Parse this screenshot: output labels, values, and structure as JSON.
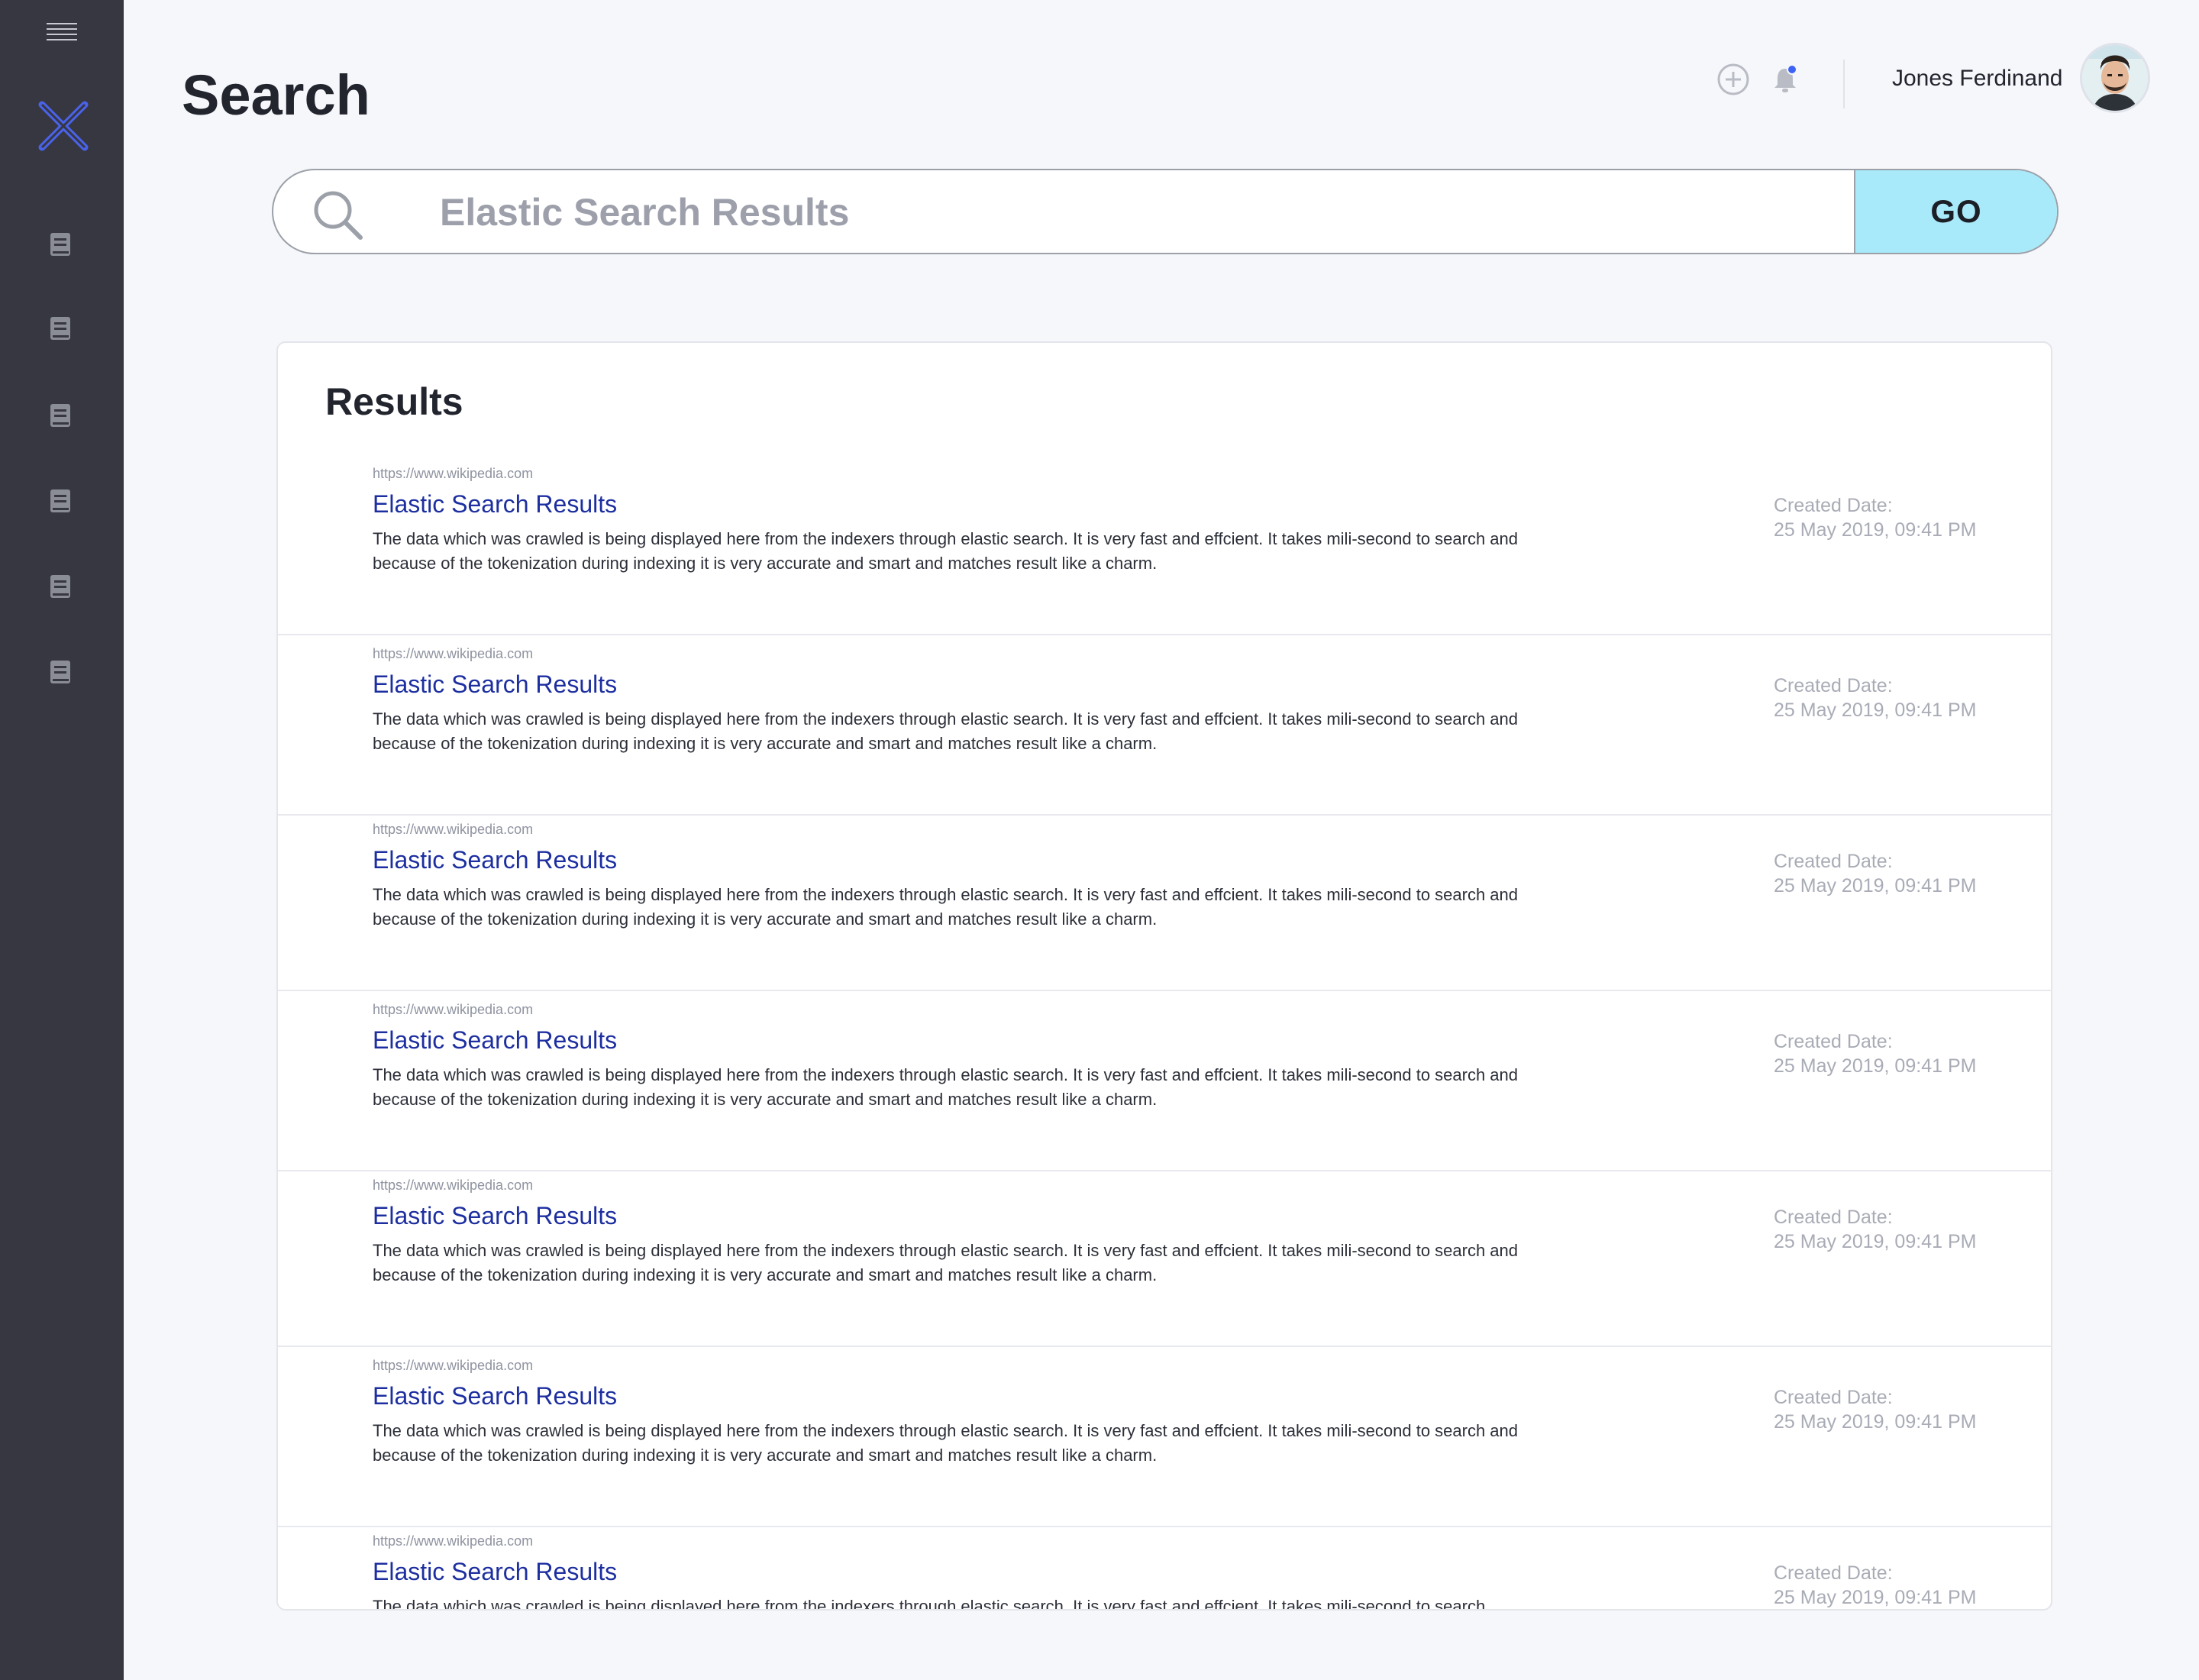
{
  "header": {
    "title": "Search",
    "user_name": "Jones Ferdinand",
    "notification_dot_color": "#3d63f5"
  },
  "sidebar": {
    "items": [
      {
        "icon": "book-icon"
      },
      {
        "icon": "book-icon"
      },
      {
        "icon": "book-icon"
      },
      {
        "icon": "book-icon"
      },
      {
        "icon": "book-icon"
      },
      {
        "icon": "book-icon"
      }
    ],
    "logo_color": "#4a62e8"
  },
  "search": {
    "placeholder": "Elastic Search Results",
    "value": "",
    "go_label": "GO",
    "go_color": "#a8eafa"
  },
  "results": {
    "title": "Results",
    "items": [
      {
        "url": "https://www.wikipedia.com",
        "title": "Elastic Search Results",
        "description": "The data which was crawled is being displayed here from the indexers through elastic search. It is very fast and effcient. It takes mili-second to search and because of the tokenization during indexing it is very accurate and smart and matches result like a charm.",
        "date_label": "Created Date:",
        "date": "25 May 2019, 09:41 PM"
      },
      {
        "url": "https://www.wikipedia.com",
        "title": "Elastic Search Results",
        "description": "The data which was crawled is being displayed here from the indexers through elastic search. It is very fast and effcient. It takes mili-second to search and because of the tokenization during indexing it is very accurate and smart and matches result like a charm.",
        "date_label": "Created Date:",
        "date": "25 May 2019, 09:41 PM"
      },
      {
        "url": "https://www.wikipedia.com",
        "title": "Elastic Search Results",
        "description": "The data which was crawled is being displayed here from the indexers through elastic search. It is very fast and effcient. It takes mili-second to search and because of the tokenization during indexing it is very accurate and smart and matches result like a charm.",
        "date_label": "Created Date:",
        "date": "25 May 2019, 09:41 PM"
      },
      {
        "url": "https://www.wikipedia.com",
        "title": "Elastic Search Results",
        "description": "The data which was crawled is being displayed here from the indexers through elastic search. It is very fast and effcient. It takes mili-second to search and because of the tokenization during indexing it is very accurate and smart and matches result like a charm.",
        "date_label": "Created Date:",
        "date": "25 May 2019, 09:41 PM"
      },
      {
        "url": "https://www.wikipedia.com",
        "title": "Elastic Search Results",
        "description": "The data which was crawled is being displayed here from the indexers through elastic search. It is very fast and effcient. It takes mili-second to search and because of the tokenization during indexing it is very accurate and smart and matches result like a charm.",
        "date_label": "Created Date:",
        "date": "25 May 2019, 09:41 PM"
      },
      {
        "url": "https://www.wikipedia.com",
        "title": "Elastic Search Results",
        "description": "The data which was crawled is being displayed here from the indexers through elastic search. It is very fast and effcient. It takes mili-second to search and because of the tokenization during indexing it is very accurate and smart and matches result like a charm.",
        "date_label": "Created Date:",
        "date": "25 May 2019, 09:41 PM"
      },
      {
        "url": "https://www.wikipedia.com",
        "title": "Elastic Search Results",
        "description": "The data which was crawled is being displayed here from the indexers through elastic search. It is very fast and effcient. It takes mili-second to search",
        "date_label": "Created Date:",
        "date": "25 May 2019, 09:41 PM"
      }
    ]
  }
}
